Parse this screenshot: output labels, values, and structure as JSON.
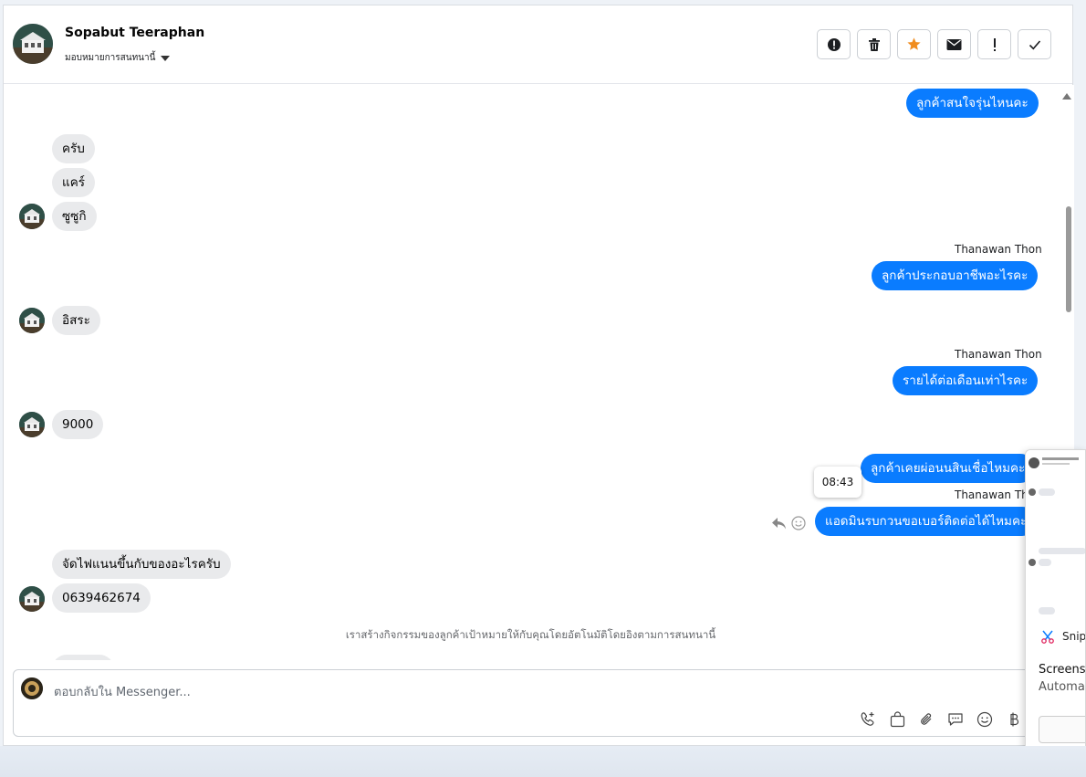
{
  "header": {
    "name": "Sopabut Teeraphan",
    "assign_label": "มอบหมายการสนทนานี้",
    "actions": [
      "report-icon",
      "trash-icon",
      "star-icon",
      "envelope-icon",
      "exclamation-icon",
      "check-icon"
    ]
  },
  "messages": {
    "m1": "ลูกค้าสนใจรุ่นไหนคะ",
    "m2": "ครับ",
    "m3": "แคร์",
    "m4": "ซูซูกิ",
    "s1": "Thanawan Thon",
    "m5": "ลูกค้าประกอบอาชีพอะไรคะ",
    "m6": "อิสระ",
    "s2": "Thanawan Thon",
    "m7": "รายได้ต่อเดือนเท่าไรคะ",
    "m8": "9000",
    "m9": "ลูกค้าเคยผ่อนนสินเชื่อไหมคะ",
    "tooltip_time": "08:43",
    "s3": "Thanawan Tho",
    "m10": "แอดมินรบกวนขอเบอร์ติดต่อได้ไหมคะ",
    "m11": "จัดไฟแนนขึ้นกับของอะไรครับ",
    "m12": "0639462674",
    "system_note": "เราสร้างกิจกรรมของลูกค้าเป้าหมายให้กับคุณโดยอัตโนมัติโดยอิงตามการสนทนานี้"
  },
  "composer": {
    "placeholder": "ตอบกลับใน Messenger...",
    "tools": [
      "phone-plus-icon",
      "shopping-bag-icon",
      "paperclip-icon",
      "chat-icon",
      "emoji-icon",
      "baht-icon"
    ]
  },
  "popup": {
    "app_label": "Snipp",
    "title": "Screensh",
    "subtitle": "Automat"
  },
  "colors": {
    "outgoing": "#0a7cff",
    "incoming": "#e9eaec",
    "star": "#f08c1e"
  }
}
